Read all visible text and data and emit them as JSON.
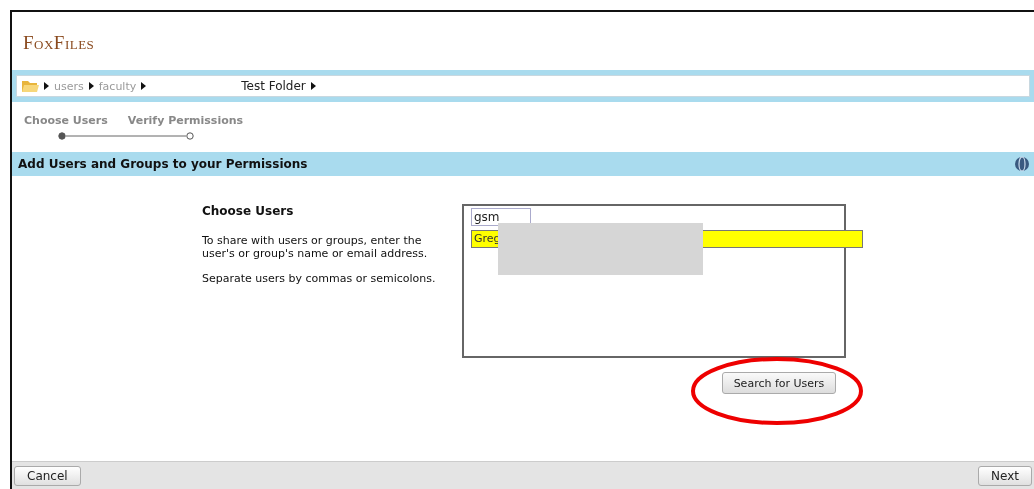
{
  "app": {
    "logo": "FoxFiles"
  },
  "breadcrumb": {
    "items": [
      {
        "label": "users",
        "current": false
      },
      {
        "label": "faculty",
        "current": false
      },
      {
        "label": "Test Folder",
        "current": true
      }
    ]
  },
  "steps": [
    {
      "label": "Choose Users",
      "selected": true
    },
    {
      "label": "Verify Permissions",
      "selected": false
    }
  ],
  "section": {
    "title": "Add Users and Groups to your Permissions"
  },
  "form": {
    "heading": "Choose Users",
    "help": [
      "To share with users or groups, enter the user's or group's name or email address.",
      "Separate users by commas or semicolons."
    ],
    "entry": "gsm",
    "suggestions": [
      {
        "label": "Greg",
        "selected": true
      }
    ],
    "search_button": "Search for Users"
  },
  "footer": {
    "cancel": "Cancel",
    "next": "Next"
  }
}
